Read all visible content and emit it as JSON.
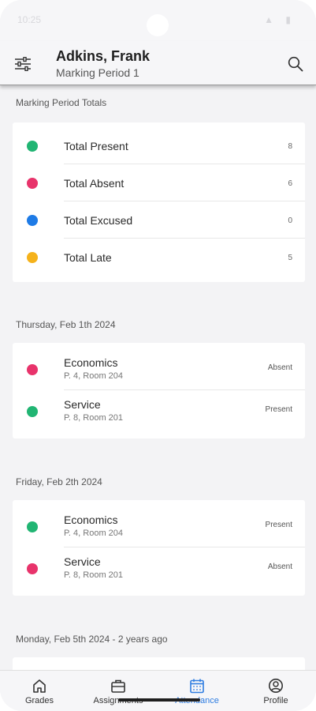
{
  "status_bar": {
    "time": "10:25",
    "icons": "▲ ▮"
  },
  "header": {
    "name": "Adkins, Frank",
    "period": "Marking Period 1"
  },
  "totals": {
    "label": "Marking Period Totals",
    "items": [
      {
        "label": "Total Present",
        "count": "8",
        "color": "#21b573"
      },
      {
        "label": "Total Absent",
        "count": "6",
        "color": "#e8336b"
      },
      {
        "label": "Total Excused",
        "count": "0",
        "color": "#1e7be6"
      },
      {
        "label": "Total Late",
        "count": "5",
        "color": "#f5b21b"
      }
    ]
  },
  "days": [
    {
      "label": "Thursday, Feb 1th 2024",
      "classes": [
        {
          "name": "Economics",
          "detail": "P. 4, Room 204",
          "status": "Absent",
          "color": "#e8336b"
        },
        {
          "name": "Service",
          "detail": "P. 8, Room 201",
          "status": "Present",
          "color": "#21b573"
        }
      ]
    },
    {
      "label": "Friday, Feb 2th 2024",
      "classes": [
        {
          "name": "Economics",
          "detail": "P. 4, Room 204",
          "status": "Present",
          "color": "#21b573"
        },
        {
          "name": "Service",
          "detail": "P. 8, Room 201",
          "status": "Absent",
          "color": "#e8336b"
        }
      ]
    },
    {
      "label": "Monday, Feb 5th 2024 - 2 years ago",
      "classes": []
    }
  ],
  "nav": {
    "items": [
      {
        "label": "Grades",
        "icon": "home-icon"
      },
      {
        "label": "Assignments",
        "icon": "briefcase-icon"
      },
      {
        "label": "Attendance",
        "icon": "calendar-icon",
        "active": true
      },
      {
        "label": "Profile",
        "icon": "account-circle-icon"
      }
    ],
    "active_color": "#2f7de1"
  }
}
